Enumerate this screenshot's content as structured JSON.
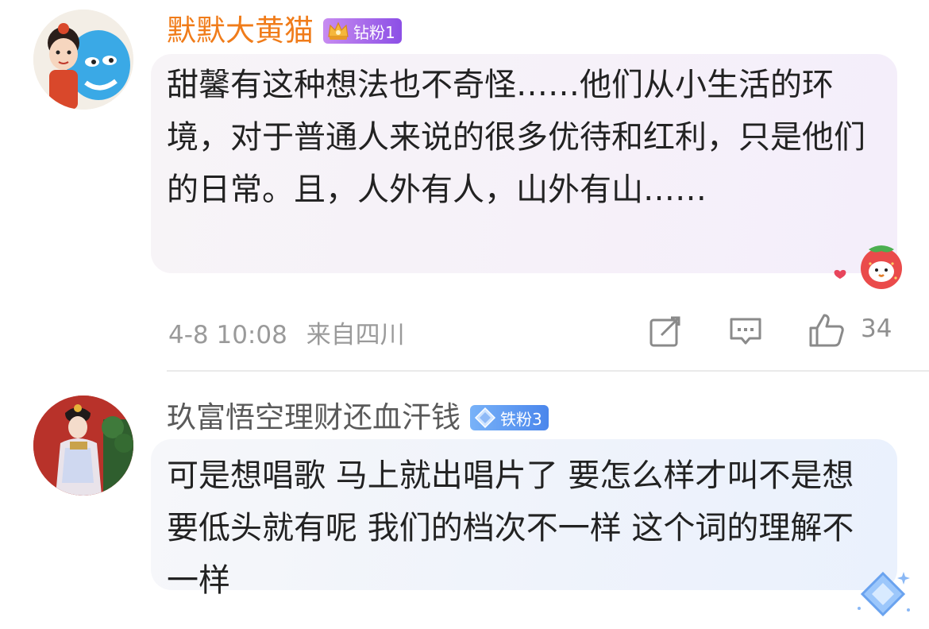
{
  "comments": [
    {
      "username": "默默大黄猫",
      "badge": "钻粉1",
      "text": "甜馨有这种想法也不奇怪……他们从小生活的环境，对于普通人来说的很多优待和红利，只是他们的日常。且，人外有人，山外有山……",
      "time": "4-8 10:08",
      "location": "来自四川",
      "like_count": "34",
      "badge_color": "#9a5cea",
      "name_color": "#f07c1a"
    },
    {
      "username": "玖富悟空理财还血汗钱",
      "badge": "铁粉3",
      "text": "可是想唱歌 马上就出唱片了 要怎么样才叫不是想要低头就有呢 我们的档次不一样 这个词的理解不一样",
      "badge_color": "#4a86ec",
      "name_color": "#5a5a5a"
    }
  ],
  "icons": {
    "share": "share-edit-icon",
    "reply": "comment-reply-icon",
    "like": "thumbs-up-icon",
    "badge_gold": "crown-icon",
    "badge_blue": "diamond-icon"
  }
}
